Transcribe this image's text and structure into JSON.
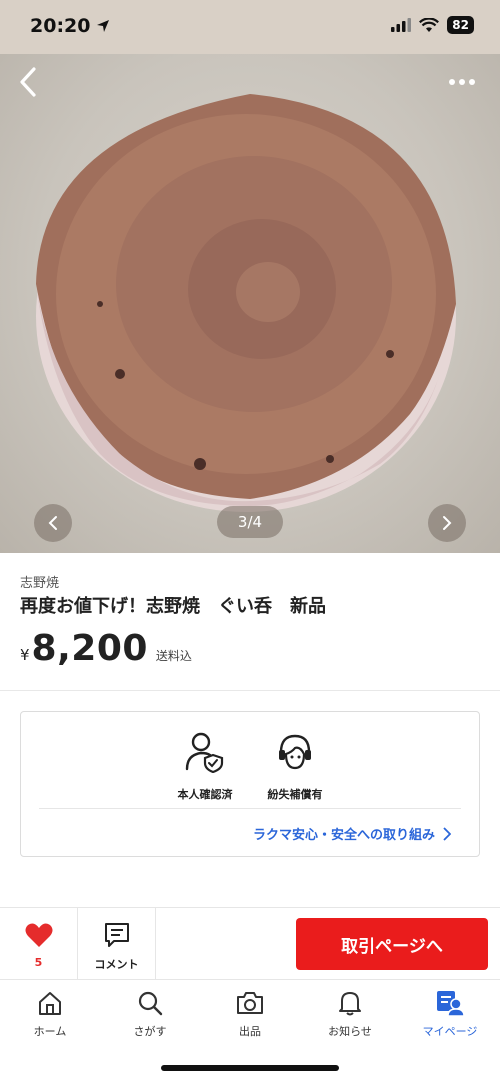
{
  "status_bar": {
    "time": "20:20",
    "battery": "82"
  },
  "gallery": {
    "counter": "3/4"
  },
  "product": {
    "brand": "志野焼",
    "title": "再度お値下げ！志野焼　ぐい呑　新品",
    "currency": "¥",
    "price": "8,200",
    "shipping": "送料込"
  },
  "safety": {
    "features": [
      {
        "label": "本人確認済",
        "icon": "verified-user-icon"
      },
      {
        "label": "紛失補償有",
        "icon": "support-agent-icon"
      }
    ],
    "link_label": "ラクマ安心・安全への取り組み"
  },
  "actions": {
    "like_count": "5",
    "comment_label": "コメント",
    "buy_label": "取引ページへ"
  },
  "tabs": [
    {
      "label": "ホーム",
      "icon": "home-icon"
    },
    {
      "label": "さがす",
      "icon": "search-icon"
    },
    {
      "label": "出品",
      "icon": "camera-icon"
    },
    {
      "label": "お知らせ",
      "icon": "bell-icon"
    },
    {
      "label": "マイページ",
      "icon": "mypage-icon",
      "active": true
    }
  ],
  "colors": {
    "accent_red": "#ea1c1c",
    "link_blue": "#2b66d9"
  }
}
